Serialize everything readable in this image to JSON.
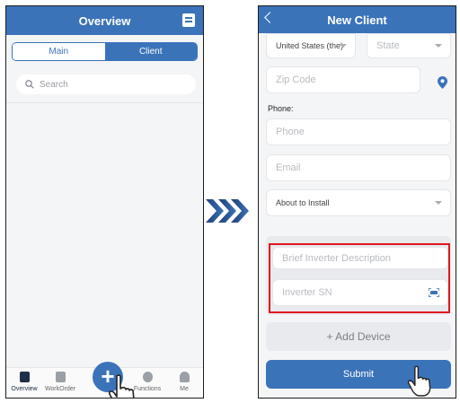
{
  "left_screen": {
    "header": {
      "title": "Overview"
    },
    "segmented": {
      "main_label": "Main",
      "client_label": "Client",
      "selected": "Client"
    },
    "search": {
      "placeholder": "Search"
    },
    "tabbar": {
      "items": [
        {
          "label": "Overview",
          "icon": "overview-icon",
          "active": true
        },
        {
          "label": "WorkOrder",
          "icon": "workorder-icon",
          "active": false
        },
        {
          "label": "Functions",
          "icon": "functions-icon",
          "active": false
        },
        {
          "label": "Me",
          "icon": "person-icon",
          "active": false
        }
      ]
    },
    "fab": {
      "label": "+"
    }
  },
  "right_screen": {
    "header": {
      "title": "New Client"
    },
    "country_select": {
      "value": "United States (the)"
    },
    "state_select": {
      "placeholder": "State"
    },
    "zip_input": {
      "placeholder": "Zip Code"
    },
    "phone_label": "Phone:",
    "phone_input": {
      "placeholder": "Phone"
    },
    "email_input": {
      "placeholder": "Email"
    },
    "status_select": {
      "value": "About to Install"
    },
    "inverter_description": {
      "placeholder": "Brief Inverter Description"
    },
    "inverter_sn": {
      "placeholder": "Inverter SN"
    },
    "add_device_button": {
      "label": "+ Add Device"
    },
    "submit_button": {
      "label": "Submit"
    }
  },
  "colors": {
    "brand_blue": "#3b73b9",
    "highlight_red": "#e1171e",
    "background": "#f4f5f7"
  }
}
